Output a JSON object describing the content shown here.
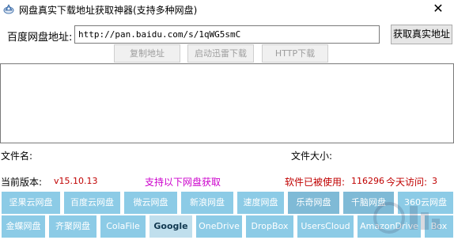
{
  "window": {
    "title": "网盘真实下载地址获取神器(支持多种网盘)",
    "close_glyph": "✕"
  },
  "url_bar": {
    "label": "百度网盘地址:",
    "value": "http://pan.baidu.com/s/1qWG5smC",
    "get_button": "获取真实地址"
  },
  "actions": {
    "copy": "复制地址",
    "thunder": "启动迅雷下载",
    "http": "HTTP下载"
  },
  "output": {
    "text": ""
  },
  "file_info": {
    "name_label": "文件名:",
    "name_value": "",
    "size_label": "文件大小:",
    "size_value": ""
  },
  "status": {
    "version_label": "当前版本:",
    "version_value": "v15.10.13",
    "supported_label": "支持以下网盘获取",
    "usage_label": "软件已被使用:",
    "usage_value": "116296",
    "today_label": "今天访问:",
    "today_value": "3"
  },
  "services_row1": [
    "坚果云网盘",
    "百度云网盘",
    "微云网盘",
    "新浪网盘",
    "速度网盘",
    "乐奇网盘",
    "千脑网盘",
    "360云网盘"
  ],
  "services_row2": [
    "金蝶网盘",
    "齐聚网盘",
    "ColaFile",
    "Google",
    "OneDrive",
    "DropBox",
    "UsersCloud",
    "AmazonDrive",
    "Box"
  ],
  "colors": {
    "service_tile": "#8ccbe6",
    "service_tile_hover": "#c0dfed",
    "version_text": "#c00000",
    "supported_text": "#cc00cc",
    "usage_text": "#c00000"
  }
}
